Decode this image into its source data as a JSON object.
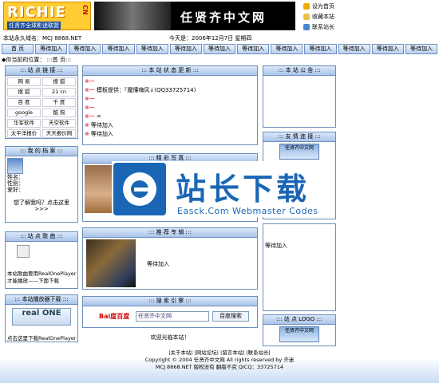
{
  "header": {
    "logo_text": "RICHIE",
    "logo_cn_mark": "CN",
    "logo_sub": "任贤齐全球影迷联盟",
    "banner_title": "任贤齐中文网",
    "top_links": [
      "设为首页",
      "收藏本站",
      "联系站长"
    ]
  },
  "info": {
    "domain_label": "本站永久域名：MCJ 8868.NET",
    "date_label": "今天是：2006年12月7日 星期四"
  },
  "nav": [
    "首 页",
    "等待加入",
    "等待加入",
    "等待加入",
    "等待加入",
    "等待加入",
    "等待加入",
    "等待加入",
    "等待加入",
    "等待加入",
    "等待加入",
    "等待加入",
    "等待加入"
  ],
  "location": "◆你当前的位置： :::首 页:::",
  "site_links": {
    "title": "::: 站 点 链 接 :::",
    "items": [
      "网 易",
      "搜 狐",
      "搜 狐",
      "21 cn",
      "百 度",
      "千 度",
      "google",
      "酷 狗",
      "华军软件",
      "天空软件",
      "太平洋报价",
      "天天报价网"
    ]
  },
  "my_profile": {
    "title": "::: 我 的 档 案 :::",
    "fields": [
      "姓名：",
      "性别：",
      "爱好："
    ],
    "more": "想了解我吗？点击这里>>>"
  },
  "song": {
    "title": "::: 站 点 歌 曲 :::",
    "note": "本站歌曲要用RealOnePlayer才能播放——下面下载"
  },
  "player": {
    "title": "::: 本站播放器下载 :::",
    "logo": "real ONE",
    "note": "点击这里下载RealOnePlayer"
  },
  "status": {
    "title": "::: 本 站 状 态 更 新 :::",
    "items": [
      {
        "tag": "※一",
        "text": ""
      },
      {
        "tag": "※一",
        "text": "模板提供：『魔懂嗨风↓(QQ33725714)"
      },
      {
        "tag": "※一",
        "text": ""
      },
      {
        "tag": "※一",
        "text": ""
      },
      {
        "tag": "※一",
        "text": "="
      },
      {
        "tag": "※",
        "text": "等待加入"
      },
      {
        "tag": "※",
        "text": "等待加入"
      }
    ]
  },
  "photos": {
    "title": "::: 精 彩 写 真 :::"
  },
  "albums": {
    "title": "::: 推 荐 专 辑 :::",
    "label": "等待加入"
  },
  "search": {
    "title": "::: 搜 索 引 擎 :::",
    "brand": "Bai度百度",
    "input": "任贤齐中文网",
    "button": "百度搜索"
  },
  "welcome": "欢迎光临本站！",
  "announce": {
    "title": "::: 本 站 公 告 :::"
  },
  "friends": {
    "title": "::: 友 情 连 接 :::",
    "logo_label": "任贤齐中文网"
  },
  "right_box": {
    "label": "等待加入"
  },
  "site_logo": {
    "title": "::: 站 点 LOGO :::",
    "logo_label": "任贤齐中文网"
  },
  "watermark": {
    "title": "站长下载",
    "sub": "Easck.Com Webmaster Codes"
  },
  "footer": {
    "links": "|关于本站| |网站论坛| |留言本站| |联系站长|",
    "copyright": "Copyright © 2004  任贤齐中文网 All rights reserved by 齐迷",
    "bottom": "MCJ 8868.NET    版权没有  翻版不究    QICQ：33725714"
  }
}
